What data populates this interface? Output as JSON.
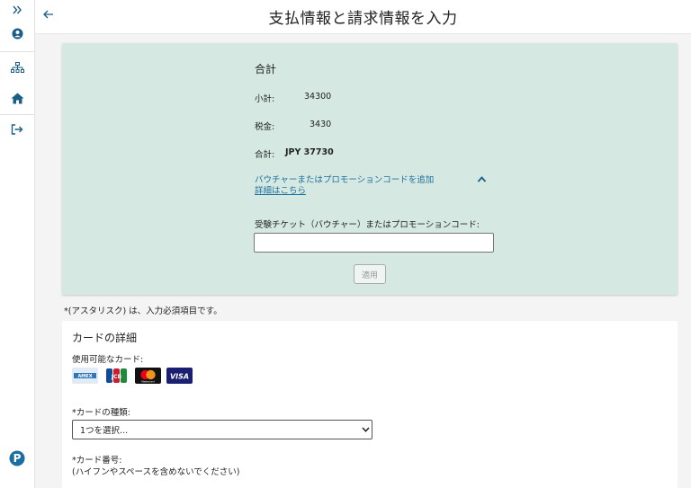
{
  "header": {
    "title": "支払情報と請求情報を入力"
  },
  "sidebar": {
    "items": [
      {
        "name": "expand",
        "icon": "double-chevron-right-icon"
      },
      {
        "name": "account",
        "icon": "user-circle-icon"
      },
      {
        "name": "sitemap",
        "icon": "sitemap-icon"
      },
      {
        "name": "home",
        "icon": "home-icon"
      },
      {
        "name": "sign-out",
        "icon": "sign-out-icon"
      },
      {
        "name": "pearson",
        "icon": "pearson-logo-icon"
      }
    ]
  },
  "summary": {
    "title": "合計",
    "subtotal_label": "小計:",
    "subtotal_value": "34300",
    "tax_label": "税金:",
    "tax_value": "3430",
    "total_label": "合計:",
    "total_value": "JPY 37730",
    "voucher_link": "バウチャーまたはプロモーションコードを追加",
    "details_link": "詳細はこちら",
    "code_label": "受験チケット（バウチャー）またはプロモーションコード:",
    "code_value": "",
    "apply_label": "適用"
  },
  "required_note": "*(アスタリスク) は、入力必須項目です。",
  "card": {
    "title": "カードの詳細",
    "available_label": "使用可能なカード:",
    "brands": [
      "AMEX",
      "JCB",
      "Mastercard",
      "VISA"
    ],
    "type_label": "*カードの種類:",
    "type_selected": "1つを選択...",
    "number_label": "*カード番号:",
    "number_hint": "(ハイフンやスペースを含めないでください)"
  },
  "colors": {
    "summary_bg": "#d5e9e2",
    "link": "#1d6f9c",
    "accent": "#1d6f9c",
    "page_bg": "#f4f4f4"
  }
}
